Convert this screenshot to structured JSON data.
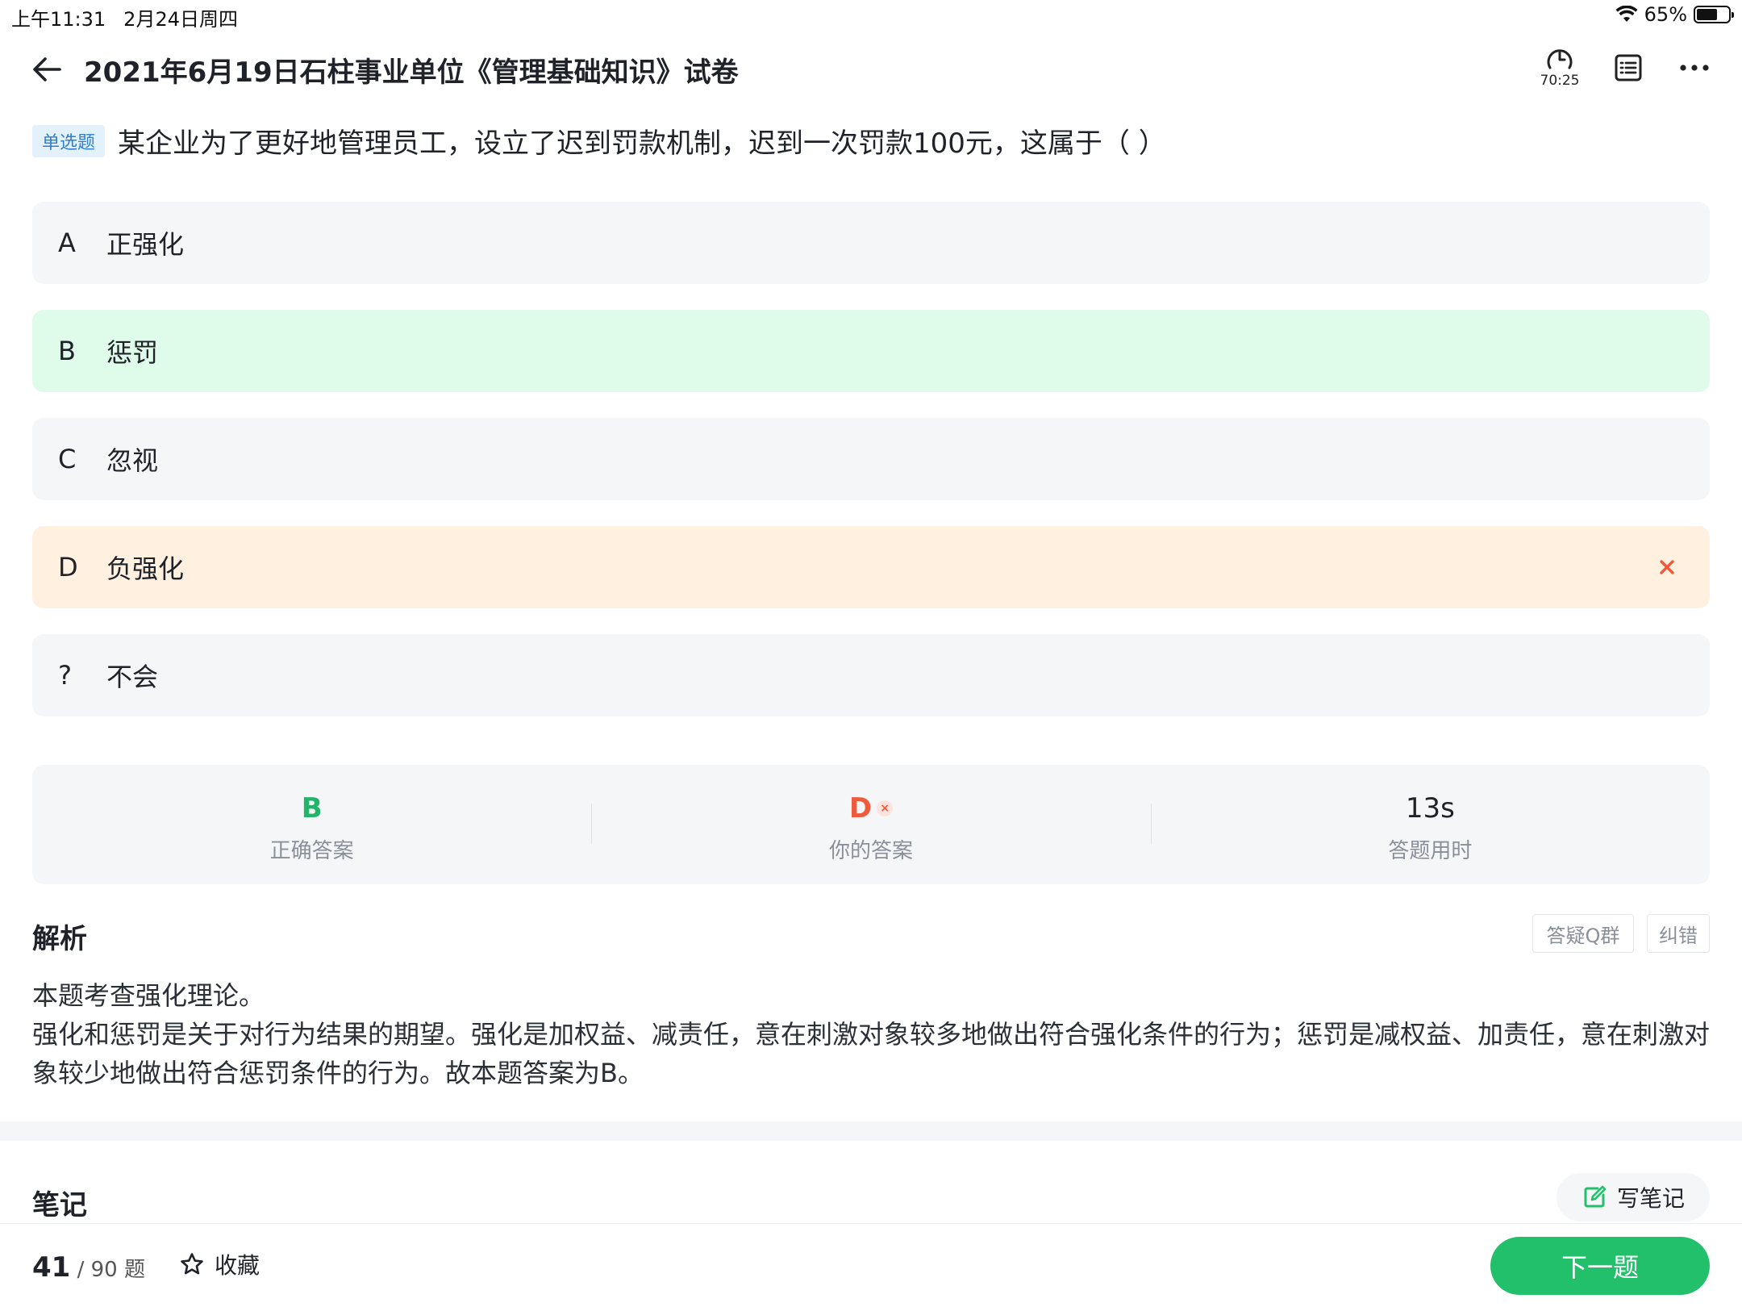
{
  "status_bar": {
    "time": "上午11:31",
    "date": "2月24日周四",
    "battery": "65%",
    "battery_level": 0.65
  },
  "header": {
    "title": "2021年6月19日石柱事业单位《管理基础知识》试卷",
    "timer": "70:25"
  },
  "question": {
    "type": "单选题",
    "text": "某企业为了更好地管理员工，设立了迟到罚款机制，迟到一次罚款100元，这属于（ ）"
  },
  "options": [
    {
      "key": "A",
      "text": "正强化",
      "state": "normal"
    },
    {
      "key": "B",
      "text": "惩罚",
      "state": "correct"
    },
    {
      "key": "C",
      "text": "忽视",
      "state": "normal"
    },
    {
      "key": "D",
      "text": "负强化",
      "state": "wrong"
    },
    {
      "key": "?",
      "text": "不会",
      "state": "normal"
    }
  ],
  "summary": {
    "correct_value": "B",
    "correct_label": "正确答案",
    "yours_value": "D",
    "yours_label": "你的答案",
    "time_value": "13s",
    "time_label": "答题用时"
  },
  "analysis": {
    "title": "解析",
    "qq_group": "答疑Q群",
    "report_error": "纠错",
    "lines": [
      "本题考查强化理论。",
      "强化和惩罚是关于对行为结果的期望。强化是加权益、减责任，意在刺激对象较多地做出符合强化条件的行为；惩罚是减权益、加责任，意在刺激对象较少地做出符合惩罚条件的行为。故本题答案为B。"
    ]
  },
  "notes": {
    "title": "笔记",
    "write_label": "写笔记"
  },
  "bottom": {
    "current": "41",
    "total": "/ 90 题",
    "favorite": "收藏",
    "next": "下一题"
  },
  "colors": {
    "green": "#22c06a",
    "red": "#f05a3c",
    "correct_bg": "#dffbe9",
    "wrong_bg": "#fff0e0"
  }
}
